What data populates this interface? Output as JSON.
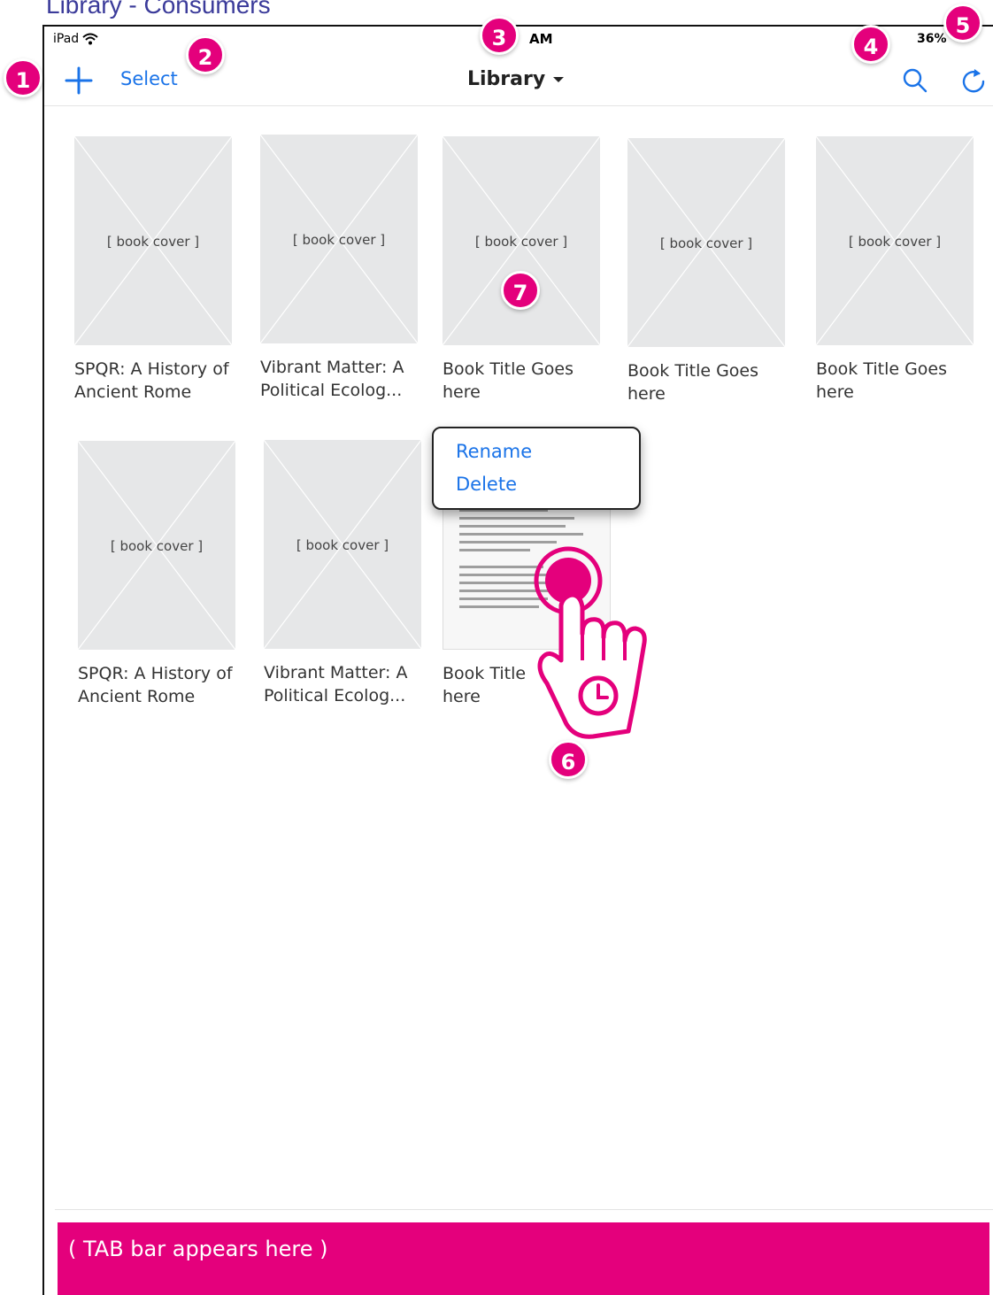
{
  "page_heading": "Library -  Consumers",
  "status_bar": {
    "device": "iPad",
    "time": "AM",
    "battery": "36%"
  },
  "nav": {
    "select_label": "Select",
    "title": "Library"
  },
  "books": [
    {
      "cover_label": "[ book cover ]",
      "title": "SPQR: A History of Ancient Rome"
    },
    {
      "cover_label": "[ book cover ]",
      "title": "Vibrant Matter: A Political Ecolog..."
    },
    {
      "cover_label": "[ book cover ]",
      "title": "Book Title Goes here"
    },
    {
      "cover_label": "[ book cover ]",
      "title": "Book Title Goes here"
    },
    {
      "cover_label": "[ book cover ]",
      "title": "Book Title Goes here"
    },
    {
      "cover_label": "[ book cover ]",
      "title": "SPQR: A History of Ancient Rome"
    },
    {
      "cover_label": "[ book cover ]",
      "title": "Vibrant Matter: A Political Ecolog..."
    },
    {
      "cover_label": "",
      "title": "Book Title here"
    }
  ],
  "context_menu": {
    "rename": "Rename",
    "delete": "Delete"
  },
  "tab_bar": {
    "label": "(  TAB bar appears here )"
  },
  "callouts": [
    "1",
    "2",
    "3",
    "4",
    "5",
    "6",
    "7"
  ],
  "colors": {
    "accent": "#1a73e8",
    "callout": "#e4007c",
    "placeholder": "#e6e7e8"
  },
  "icons": {
    "add": "plus-icon",
    "search": "search-icon",
    "refresh": "refresh-icon",
    "dropdown": "chevron-down-icon",
    "wifi": "wifi-icon",
    "gesture": "long-press-hand-icon"
  }
}
